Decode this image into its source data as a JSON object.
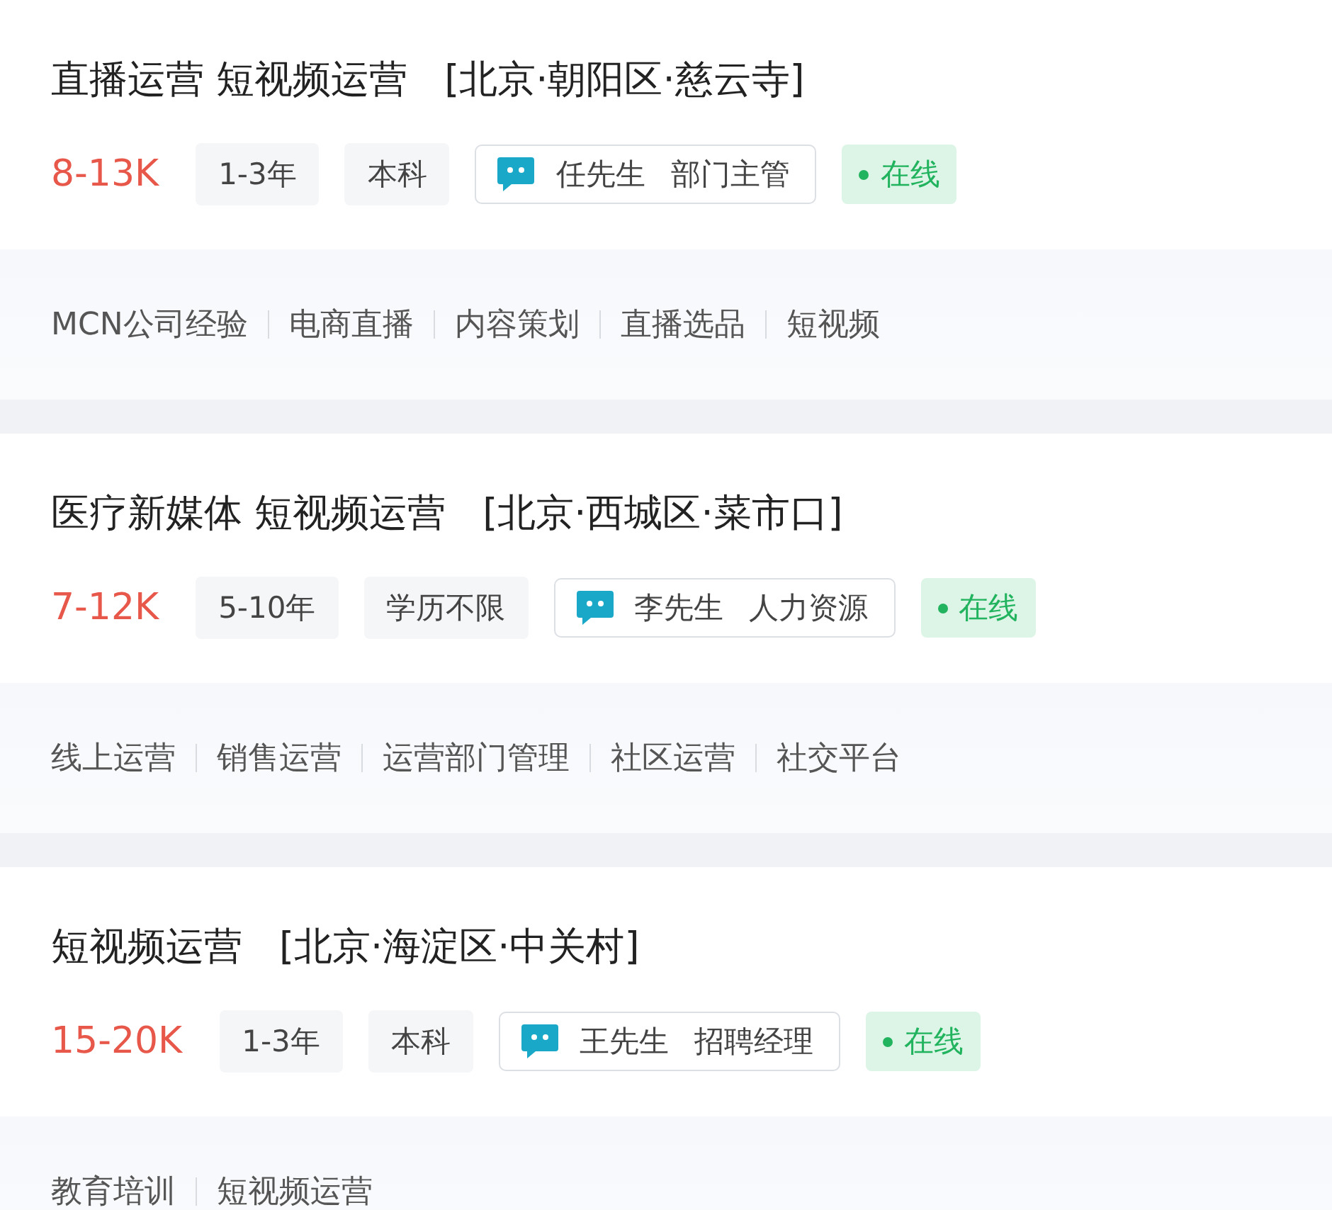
{
  "jobs": [
    {
      "title": "直播运营 短视频运营",
      "location": "[北京·朝阳区·慈云寺]",
      "salary": "8-13K",
      "experience": "1-3年",
      "education": "本科",
      "recruiter": "任先生",
      "recruiter_role": "部门主管",
      "status": "在线",
      "tags": [
        "MCN公司经验",
        "电商直播",
        "内容策划",
        "直播选品",
        "短视频"
      ]
    },
    {
      "title": "医疗新媒体 短视频运营",
      "location": "[北京·西城区·菜市口]",
      "salary": "7-12K",
      "experience": "5-10年",
      "education": "学历不限",
      "recruiter": "李先生",
      "recruiter_role": "人力资源",
      "status": "在线",
      "tags": [
        "线上运营",
        "销售运营",
        "运营部门管理",
        "社区运营",
        "社交平台"
      ]
    },
    {
      "title": "短视频运营",
      "location": "[北京·海淀区·中关村]",
      "salary": "15-20K",
      "experience": "1-3年",
      "education": "本科",
      "recruiter": "王先生",
      "recruiter_role": "招聘经理",
      "status": "在线",
      "tags": [
        "教育培训",
        "短视频运营"
      ]
    }
  ]
}
